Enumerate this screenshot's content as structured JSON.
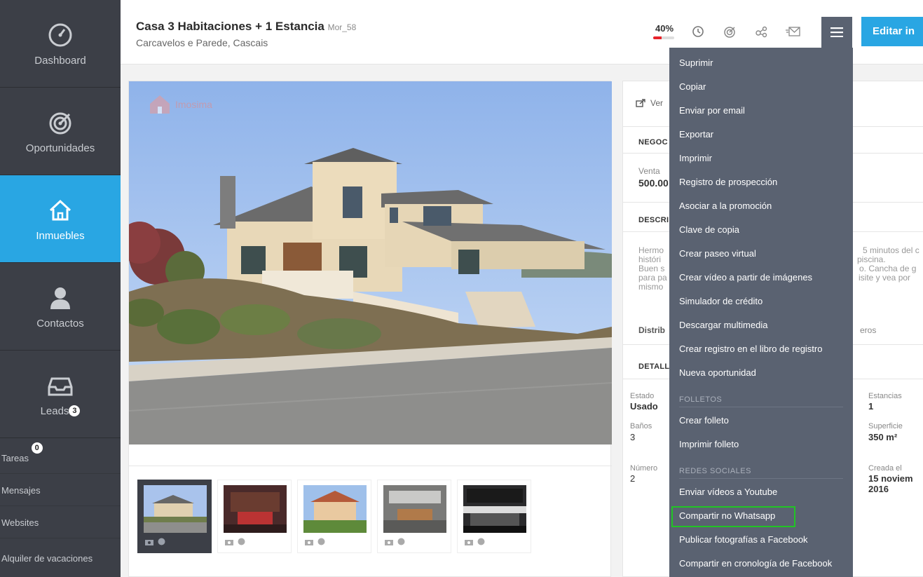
{
  "sidebar": {
    "dashboard": "Dashboard",
    "oportunidades": "Oportunidades",
    "inmuebles": "Inmuebles",
    "contactos": "Contactos",
    "leads": "Leads",
    "leads_count": "3",
    "tareas": "Tareas",
    "tareas_count": "0",
    "mensajes": "Mensajes",
    "websites": "Websites",
    "alquiler": "Alquiler de vacaciones"
  },
  "header": {
    "title": "Casa 3 Habitaciones + 1 Estancia",
    "ref": "Mor_58",
    "subtitle": "Carcavelos e Parede, Cascais",
    "progress_text": "40%",
    "progress_value": 40,
    "edit_label": "Editar in"
  },
  "photo": {
    "watermark": "Imosima"
  },
  "detail": {
    "ver": "Ver",
    "negocio_head": "NEGOC",
    "venta_label": "Venta",
    "precio": "500.00",
    "descripcion_head": "DESCRI",
    "desc_left": [
      "Hermo",
      "históri",
      "Buen s",
      "para pa",
      "mismo"
    ],
    "desc_right": [
      "5 minutos del c",
      "piscina.",
      "o. Cancha de g",
      "isite y vea por"
    ],
    "distrib_left": "Distrib",
    "distrib_right": "eros",
    "detalles_head": "DETALL",
    "estado_label": "Estado",
    "estado_value": "Usado",
    "banos_label": "Baños",
    "banos_value": "3",
    "numero_label": "Número",
    "numero_value": "2",
    "estancias_label": "Estancias",
    "estancias_value": "1",
    "superficie_label": "Superficie",
    "superficie_value": "350 m²",
    "creada_label": "Creada el",
    "creada_value_1": "15 noviem",
    "creada_value_2": "2016"
  },
  "menu": {
    "items": [
      "Suprimir",
      "Copiar",
      "Enviar por email",
      "Exportar",
      "Imprimir",
      "Registro de prospección",
      "Asociar a la promoción",
      "Clave de copia",
      "Crear paseo virtual",
      "Crear vídeo a partir de imágenes",
      "Simulador de crédito",
      "Descargar multimedia",
      "Crear registro en el libro de registro",
      "Nueva oportunidad"
    ],
    "folletos_head": "FOLLETOS",
    "folletos": [
      "Crear folleto",
      "Imprimir folleto"
    ],
    "redes_head": "REDES SOCIALES",
    "redes": [
      "Enviar vídeos a Youtube",
      "Compartir no Whatsapp",
      "Publicar fotografías a Facebook",
      "Compartir en cronología de Facebook"
    ]
  },
  "colors": {
    "sidebar": "#3c3f47",
    "accent": "#29a6e3",
    "menu": "#5a6271",
    "highlight": "#21c425",
    "progress": "#e8232b"
  }
}
